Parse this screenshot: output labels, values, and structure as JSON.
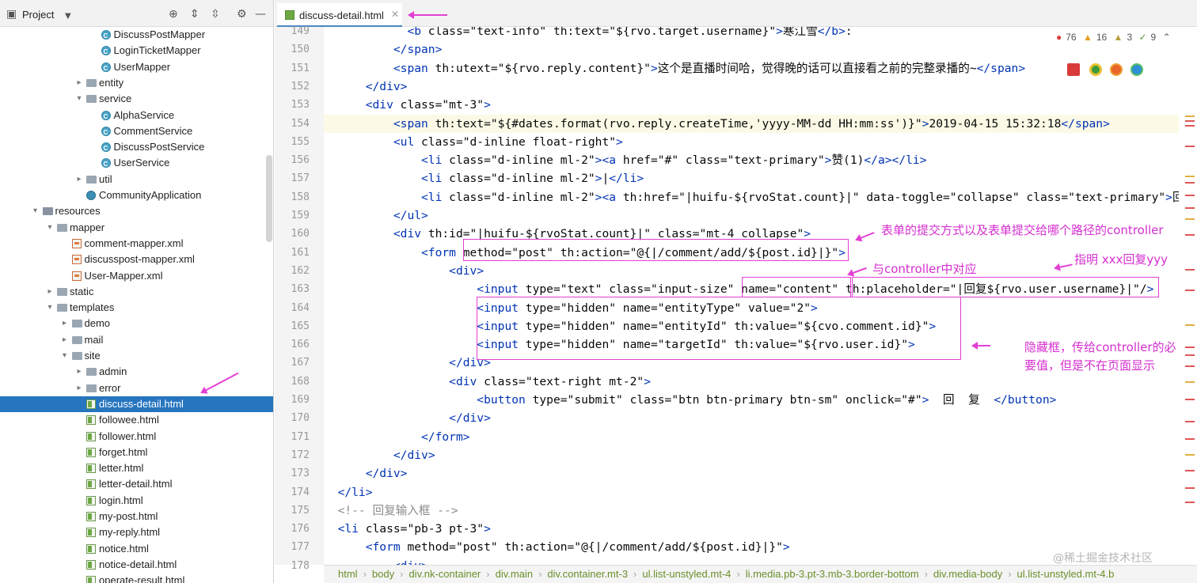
{
  "project_panel": {
    "title": "Project",
    "tree": [
      {
        "label": "DiscussPostMapper",
        "icon": "interface-icon",
        "depth": 7,
        "arrow": ""
      },
      {
        "label": "LoginTicketMapper",
        "icon": "interface-icon",
        "depth": 7,
        "arrow": ""
      },
      {
        "label": "UserMapper",
        "icon": "interface-icon",
        "depth": 7,
        "arrow": ""
      },
      {
        "label": "entity",
        "icon": "folder-icon",
        "depth": 6,
        "arrow": "▸"
      },
      {
        "label": "service",
        "icon": "folder-icon",
        "depth": 6,
        "arrow": "▾"
      },
      {
        "label": "AlphaService",
        "icon": "class-icon",
        "depth": 7,
        "arrow": ""
      },
      {
        "label": "CommentService",
        "icon": "class-icon",
        "depth": 7,
        "arrow": ""
      },
      {
        "label": "DiscussPostService",
        "icon": "class-icon",
        "depth": 7,
        "arrow": ""
      },
      {
        "label": "UserService",
        "icon": "class-icon",
        "depth": 7,
        "arrow": ""
      },
      {
        "label": "util",
        "icon": "folder-icon",
        "depth": 6,
        "arrow": "▸"
      },
      {
        "label": "CommunityApplication",
        "icon": "app-class-icon",
        "depth": 6,
        "arrow": ""
      },
      {
        "label": "resources",
        "icon": "resources-folder-icon",
        "depth": 3,
        "arrow": "▾"
      },
      {
        "label": "mapper",
        "icon": "folder-icon",
        "depth": 4,
        "arrow": "▾"
      },
      {
        "label": "comment-mapper.xml",
        "icon": "xml-file-icon",
        "depth": 5,
        "arrow": ""
      },
      {
        "label": "discusspost-mapper.xml",
        "icon": "xml-file-icon",
        "depth": 5,
        "arrow": ""
      },
      {
        "label": "User-Mapper.xml",
        "icon": "xml-file-icon",
        "depth": 5,
        "arrow": ""
      },
      {
        "label": "static",
        "icon": "folder-icon",
        "depth": 4,
        "arrow": "▸"
      },
      {
        "label": "templates",
        "icon": "folder-icon",
        "depth": 4,
        "arrow": "▾"
      },
      {
        "label": "demo",
        "icon": "folder-icon",
        "depth": 5,
        "arrow": "▸"
      },
      {
        "label": "mail",
        "icon": "folder-icon",
        "depth": 5,
        "arrow": "▸"
      },
      {
        "label": "site",
        "icon": "folder-icon",
        "depth": 5,
        "arrow": "▾"
      },
      {
        "label": "admin",
        "icon": "folder-icon",
        "depth": 6,
        "arrow": "▸"
      },
      {
        "label": "error",
        "icon": "folder-icon",
        "depth": 6,
        "arrow": "▸"
      },
      {
        "label": "discuss-detail.html",
        "icon": "html-file-icon",
        "depth": 6,
        "arrow": "",
        "selected": true
      },
      {
        "label": "followee.html",
        "icon": "html-file-icon",
        "depth": 6,
        "arrow": ""
      },
      {
        "label": "follower.html",
        "icon": "html-file-icon",
        "depth": 6,
        "arrow": ""
      },
      {
        "label": "forget.html",
        "icon": "html-file-icon",
        "depth": 6,
        "arrow": ""
      },
      {
        "label": "letter.html",
        "icon": "html-file-icon",
        "depth": 6,
        "arrow": ""
      },
      {
        "label": "letter-detail.html",
        "icon": "html-file-icon",
        "depth": 6,
        "arrow": ""
      },
      {
        "label": "login.html",
        "icon": "html-file-icon",
        "depth": 6,
        "arrow": ""
      },
      {
        "label": "my-post.html",
        "icon": "html-file-icon",
        "depth": 6,
        "arrow": ""
      },
      {
        "label": "my-reply.html",
        "icon": "html-file-icon",
        "depth": 6,
        "arrow": ""
      },
      {
        "label": "notice.html",
        "icon": "html-file-icon",
        "depth": 6,
        "arrow": ""
      },
      {
        "label": "notice-detail.html",
        "icon": "html-file-icon",
        "depth": 6,
        "arrow": ""
      },
      {
        "label": "operate-result.html",
        "icon": "html-file-icon",
        "depth": 6,
        "arrow": ""
      }
    ]
  },
  "editor": {
    "tab_label": "discuss-detail.html",
    "inspections": {
      "errors": "76",
      "warnings": "16",
      "weak": "3",
      "typos": "9"
    },
    "lines": [
      {
        "n": "149",
        "text": "            <b class=\"text-info\" th:text=\"${rvo.target.username}\">寒江雪</b>:"
      },
      {
        "n": "150",
        "text": "          </span>"
      },
      {
        "n": "151",
        "text": "          <span th:utext=\"${rvo.reply.content}\">这个是直播时间哈，觉得晚的话可以直接看之前的完整录播的~</span>"
      },
      {
        "n": "152",
        "text": "      </div>"
      },
      {
        "n": "153",
        "text": "      <div class=\"mt-3\">"
      },
      {
        "n": "154",
        "text": "          <span th:text=\"${#dates.format(rvo.reply.createTime,'yyyy-MM-dd HH:mm:ss')}\">2019-04-15 15:32:18</span>",
        "highlight": true
      },
      {
        "n": "155",
        "text": "          <ul class=\"d-inline float-right\">"
      },
      {
        "n": "156",
        "text": "              <li class=\"d-inline ml-2\"><a href=\"#\" class=\"text-primary\">赞(1)</a></li>"
      },
      {
        "n": "157",
        "text": "              <li class=\"d-inline ml-2\">|</li>"
      },
      {
        "n": "158",
        "text": "              <li class=\"d-inline ml-2\"><a th:href=\"|huifu-${rvoStat.count}|\" data-toggle=\"collapse\" class=\"text-primary\">回"
      },
      {
        "n": "159",
        "text": "          </ul>"
      },
      {
        "n": "160",
        "text": "          <div th:id=\"|huifu-${rvoStat.count}|\" class=\"mt-4 collapse\">"
      },
      {
        "n": "161",
        "text": "              <form method=\"post\" th:action=\"@{|/comment/add/${post.id}|}\">"
      },
      {
        "n": "162",
        "text": "                  <div>"
      },
      {
        "n": "163",
        "text": "                      <input type=\"text\" class=\"input-size\" name=\"content\" th:placeholder=\"|回复${rvo.user.username}|\"/>"
      },
      {
        "n": "164",
        "text": "                      <input type=\"hidden\" name=\"entityType\" value=\"2\">"
      },
      {
        "n": "165",
        "text": "                      <input type=\"hidden\" name=\"entityId\" th:value=\"${cvo.comment.id}\">"
      },
      {
        "n": "166",
        "text": "                      <input type=\"hidden\" name=\"targetId\" th:value=\"${rvo.user.id}\">"
      },
      {
        "n": "167",
        "text": "                  </div>"
      },
      {
        "n": "168",
        "text": "                  <div class=\"text-right mt-2\">"
      },
      {
        "n": "169",
        "text": "                      <button type=\"submit\" class=\"btn btn-primary btn-sm\" onclick=\"#\">  回  复  </button>"
      },
      {
        "n": "170",
        "text": "                  </div>"
      },
      {
        "n": "171",
        "text": "              </form>"
      },
      {
        "n": "172",
        "text": "          </div>"
      },
      {
        "n": "173",
        "text": "      </div>"
      },
      {
        "n": "174",
        "text": "  </li>"
      },
      {
        "n": "175",
        "text": "  <!-- 回复输入框 -->"
      },
      {
        "n": "176",
        "text": "  <li class=\"pb-3 pt-3\">"
      },
      {
        "n": "177",
        "text": "      <form method=\"post\" th:action=\"@{|/comment/add/${post.id}|}\">"
      },
      {
        "n": "178",
        "text": "          <div>"
      }
    ]
  },
  "breadcrumb": [
    "html",
    "body",
    "div.nk-container",
    "div.main",
    "div.container.mt-3",
    "ul.list-unstyled.mt-4",
    "li.media.pb-3.pt-3.mb-3.border-bottom",
    "div.media-body",
    "ul.list-unstyled.mt-4.b"
  ],
  "annotations": {
    "form_note": "表单的提交方式以及表单提交给哪个路径的controller",
    "name_note": "与controller中对应",
    "placeholder_note": "指明 xxx回复yyy",
    "hidden_note_line1": "隐藏框，传给controller的必",
    "hidden_note_line2": "要值，但是不在页面显示"
  },
  "watermark": "@稀土掘金技术社区",
  "colors": {
    "accent": "#2675bf",
    "annotation": "#e33fd3",
    "tag": "#0033b3",
    "attr": "#174ad4",
    "string": "#067d17"
  }
}
